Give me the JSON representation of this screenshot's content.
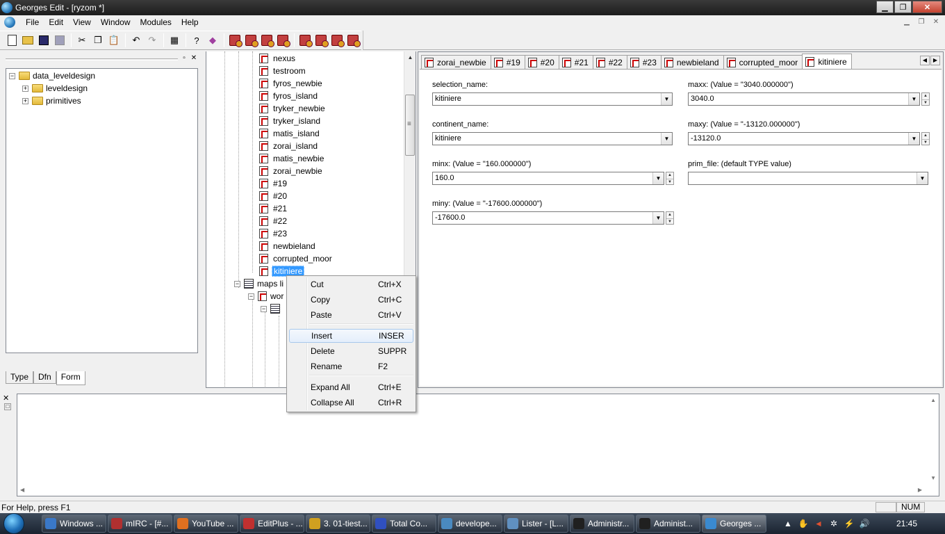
{
  "window": {
    "title": "Georges Edit - [ryzom *]"
  },
  "menubar": {
    "items": [
      "File",
      "Edit",
      "View",
      "Window",
      "Modules",
      "Help"
    ]
  },
  "left_panel": {
    "tree": [
      {
        "label": "data_leveldesign",
        "expander": "−"
      },
      {
        "label": "leveldesign",
        "expander": "+"
      },
      {
        "label": "primitives",
        "expander": "+"
      }
    ],
    "tabs": [
      "Type",
      "Dfn",
      "Form"
    ],
    "active_tab": "Form"
  },
  "middle_tree": {
    "nodes": [
      "nexus",
      "testroom",
      "fyros_newbie",
      "fyros_island",
      "tryker_newbie",
      "tryker_island",
      "matis_island",
      "zorai_island",
      "matis_newbie",
      "zorai_newbie",
      "#19",
      "#20",
      "#21",
      "#22",
      "#23",
      "newbieland",
      "corrupted_moor",
      "kitiniere"
    ],
    "selected": "kitiniere",
    "maps_list_label": "maps li",
    "world_label": "wor"
  },
  "form_tabs": [
    "zorai_newbie",
    "#19",
    "#20",
    "#21",
    "#22",
    "#23",
    "newbieland",
    "corrupted_moor",
    "kitiniere"
  ],
  "active_form_tab": "kitiniere",
  "form_fields": {
    "selection_name": {
      "label": "selection_name:",
      "value": "kitiniere"
    },
    "continent_name": {
      "label": "continent_name:",
      "value": "kitiniere"
    },
    "minx": {
      "label": "minx: (Value = \"160.000000\")",
      "value": "160.0"
    },
    "miny": {
      "label": "miny: (Value = \"-17600.000000\")",
      "value": "-17600.0"
    },
    "maxx": {
      "label": "maxx: (Value = \"3040.000000\")",
      "value": "3040.0"
    },
    "maxy": {
      "label": "maxy: (Value = \"-13120.000000\")",
      "value": "-13120.0"
    },
    "prim_file": {
      "label": "prim_file: (default TYPE value)",
      "value": ""
    }
  },
  "context_menu": {
    "items": [
      {
        "label": "Cut",
        "shortcut": "Ctrl+X"
      },
      {
        "label": "Copy",
        "shortcut": "Ctrl+C"
      },
      {
        "label": "Paste",
        "shortcut": "Ctrl+V"
      },
      {
        "label": "Insert",
        "shortcut": "INSER"
      },
      {
        "label": "Delete",
        "shortcut": "SUPPR"
      },
      {
        "label": "Rename",
        "shortcut": "F2"
      },
      {
        "label": "Expand All",
        "shortcut": "Ctrl+E"
      },
      {
        "label": "Collapse All",
        "shortcut": "Ctrl+R"
      }
    ],
    "highlighted": "Insert"
  },
  "statusbar": {
    "help": "For Help, press F1",
    "num": "NUM"
  },
  "taskbar": {
    "buttons": [
      {
        "label": "Windows ...",
        "color": "#3a78c8"
      },
      {
        "label": "mIRC - [#...",
        "color": "#b03030"
      },
      {
        "label": "YouTube ...",
        "color": "#e07020"
      },
      {
        "label": "EditPlus - ...",
        "color": "#c03030"
      },
      {
        "label": "3. 01-tiest...",
        "color": "#d0a020"
      },
      {
        "label": "Total Co...",
        "color": "#3050c0"
      },
      {
        "label": "develope...",
        "color": "#4a8ac0"
      },
      {
        "label": "Lister - [L...",
        "color": "#6090c0"
      },
      {
        "label": "Administr...",
        "color": "#202020"
      },
      {
        "label": "Administ...",
        "color": "#202020"
      },
      {
        "label": "Georges ...",
        "color": "#3a8ad0"
      }
    ],
    "active": "Georges ...",
    "clock": "21:45"
  }
}
